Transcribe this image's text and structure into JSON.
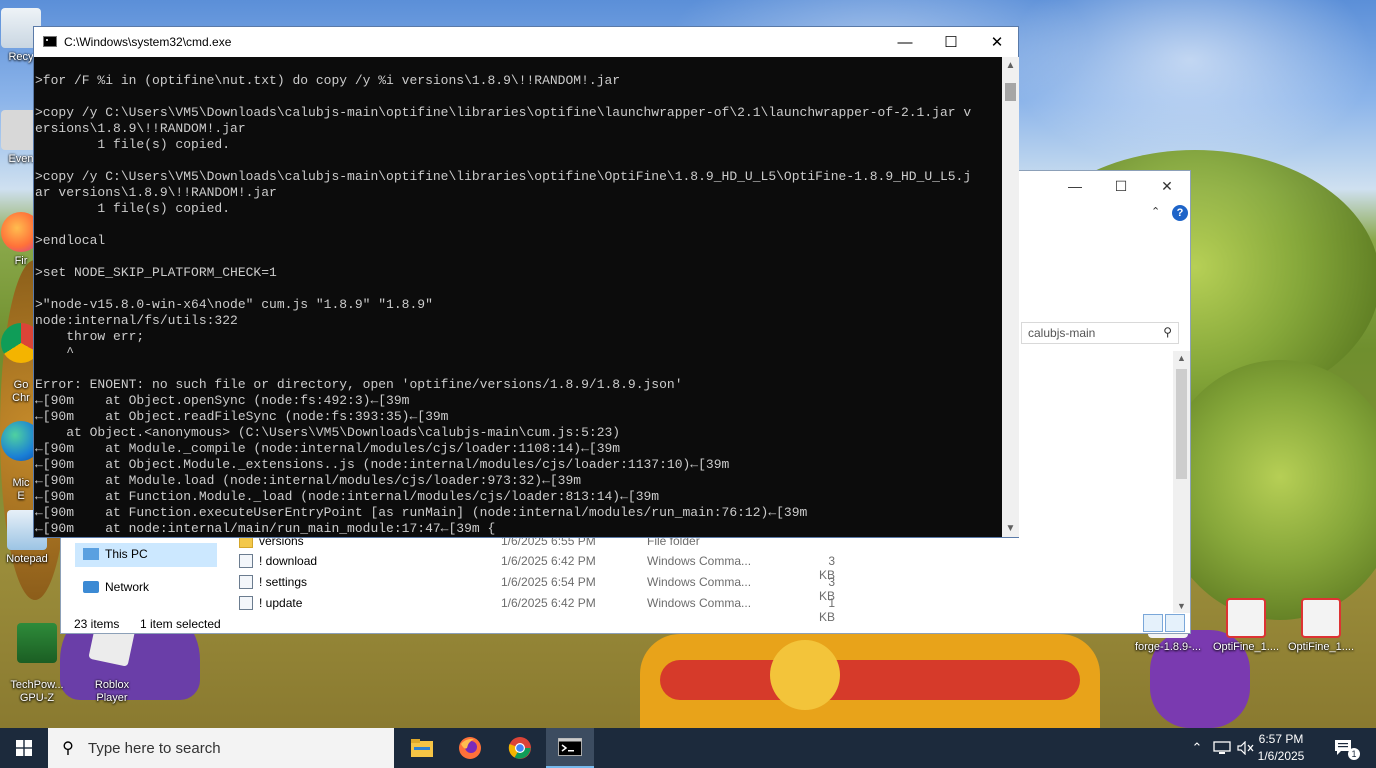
{
  "desktop": {
    "icons_left": [
      {
        "label": "Recy",
        "icon": "recycle-bin-icon"
      },
      {
        "label": "Even",
        "icon": "app-shortcut-icon"
      },
      {
        "label": "Fir",
        "icon": "firefox-icon"
      },
      {
        "label": "Go\nChr",
        "icon": "chrome-icon"
      },
      {
        "label": "Mic\nE",
        "icon": "edge-icon"
      },
      {
        "label": "Notepad",
        "icon": "notepad-icon"
      }
    ],
    "icons_bottom_left": [
      {
        "label": "TechPow...\nGPU-Z",
        "icon": "gpuz-icon"
      },
      {
        "label": "Roblox\nPlayer",
        "icon": "roblox-icon"
      }
    ],
    "icons_bottom_right": [
      {
        "label": "forge-1.8.9-...",
        "icon": "java-file-icon"
      },
      {
        "label": "OptiFine_1....",
        "icon": "java-file-icon"
      },
      {
        "label": "OptiFine_1....",
        "icon": "java-file-icon"
      }
    ]
  },
  "explorer": {
    "search_placeholder": "calubjs-main",
    "nav": [
      {
        "label": "This PC",
        "selected": true
      },
      {
        "label": "Network",
        "selected": false
      }
    ],
    "files": [
      {
        "name": "versions",
        "date": "1/6/2025 6:55 PM",
        "type": "File folder",
        "size": ""
      },
      {
        "name": "! download",
        "date": "1/6/2025 6:42 PM",
        "type": "Windows Comma...",
        "size": "3 KB"
      },
      {
        "name": "! settings",
        "date": "1/6/2025 6:54 PM",
        "type": "Windows Comma...",
        "size": "3 KB"
      },
      {
        "name": "! update",
        "date": "1/6/2025 6:42 PM",
        "type": "Windows Comma...",
        "size": "1 KB"
      }
    ],
    "status_items": "23 items",
    "status_selected": "1 item selected"
  },
  "cmd": {
    "title": "C:\\Windows\\system32\\cmd.exe",
    "lines": [
      ">for /F %i in (optifine\\nut.txt) do copy /y %i versions\\1.8.9\\!!RANDOM!.jar",
      "",
      ">copy /y C:\\Users\\VM5\\Downloads\\calubjs-main\\optifine\\libraries\\optifine\\launchwrapper-of\\2.1\\launchwrapper-of-2.1.jar v",
      "ersions\\1.8.9\\!!RANDOM!.jar",
      "        1 file(s) copied.",
      "",
      ">copy /y C:\\Users\\VM5\\Downloads\\calubjs-main\\optifine\\libraries\\optifine\\OptiFine\\1.8.9_HD_U_L5\\OptiFine-1.8.9_HD_U_L5.j",
      "ar versions\\1.8.9\\!!RANDOM!.jar",
      "        1 file(s) copied.",
      "",
      ">endlocal",
      "",
      ">set NODE_SKIP_PLATFORM_CHECK=1",
      "",
      ">\"node-v15.8.0-win-x64\\node\" cum.js \"1.8.9\" \"1.8.9\"",
      "node:internal/fs/utils:322",
      "    throw err;",
      "    ^",
      "",
      "Error: ENOENT: no such file or directory, open 'optifine/versions/1.8.9/1.8.9.json'",
      "←[90m    at Object.openSync (node:fs:492:3)←[39m",
      "←[90m    at Object.readFileSync (node:fs:393:35)←[39m",
      "    at Object.<anonymous> (C:\\Users\\VM5\\Downloads\\calubjs-main\\cum.js:5:23)",
      "←[90m    at Module._compile (node:internal/modules/cjs/loader:1108:14)←[39m",
      "←[90m    at Object.Module._extensions..js (node:internal/modules/cjs/loader:1137:10)←[39m",
      "←[90m    at Module.load (node:internal/modules/cjs/loader:973:32)←[39m",
      "←[90m    at Function.Module._load (node:internal/modules/cjs/loader:813:14)←[39m",
      "←[90m    at Function.executeUserEntryPoint [as runMain] (node:internal/modules/run_main:76:12)←[39m",
      "←[90m    at node:internal/main/run_main_module:17:47←[39m {"
    ]
  },
  "taskbar": {
    "search_placeholder": "Type here to search",
    "apps": [
      {
        "name": "File Explorer",
        "icon": "file-explorer-icon",
        "active": false
      },
      {
        "name": "Firefox",
        "icon": "firefox-icon",
        "active": false
      },
      {
        "name": "Chrome",
        "icon": "chrome-icon",
        "active": false
      },
      {
        "name": "Command Prompt",
        "icon": "cmd-icon",
        "active": true
      }
    ],
    "time": "6:57 PM",
    "date": "1/6/2025",
    "notification_count": "1"
  },
  "colors": {
    "console_bg": "#0c0c0c",
    "console_text": "#cccccc",
    "taskbar_bg": "#1c2a3c",
    "selection": "#cce8ff"
  }
}
